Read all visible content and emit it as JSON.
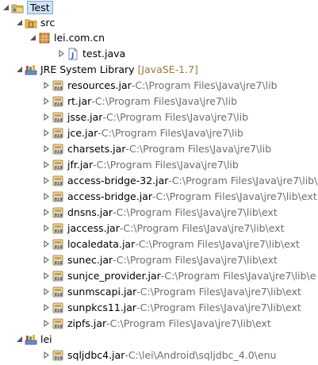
{
  "project": {
    "name": "Test"
  },
  "src": {
    "label": "src"
  },
  "package": {
    "label": "lei.com.cn"
  },
  "file": {
    "label": "test.java"
  },
  "jre": {
    "label": "JRE System Library",
    "version": "[JavaSE-1.7]"
  },
  "jars": [
    {
      "name": "resources.jar",
      "path": "C:\\Program Files\\Java\\jre7\\lib"
    },
    {
      "name": "rt.jar",
      "path": "C:\\Program Files\\Java\\jre7\\lib"
    },
    {
      "name": "jsse.jar",
      "path": "C:\\Program Files\\Java\\jre7\\lib"
    },
    {
      "name": "jce.jar",
      "path": "C:\\Program Files\\Java\\jre7\\lib"
    },
    {
      "name": "charsets.jar",
      "path": "C:\\Program Files\\Java\\jre7\\lib"
    },
    {
      "name": "jfr.jar",
      "path": "C:\\Program Files\\Java\\jre7\\lib"
    },
    {
      "name": "access-bridge-32.jar",
      "path": "C:\\Program Files\\Java\\jre7\\lib\\"
    },
    {
      "name": "access-bridge.jar",
      "path": "C:\\Program Files\\Java\\jre7\\lib\\ext"
    },
    {
      "name": "dnsns.jar",
      "path": "C:\\Program Files\\Java\\jre7\\lib\\ext"
    },
    {
      "name": "jaccess.jar",
      "path": "C:\\Program Files\\Java\\jre7\\lib\\ext"
    },
    {
      "name": "localedata.jar",
      "path": "C:\\Program Files\\Java\\jre7\\lib\\ext"
    },
    {
      "name": "sunec.jar",
      "path": "C:\\Program Files\\Java\\jre7\\lib\\ext"
    },
    {
      "name": "sunjce_provider.jar",
      "path": "C:\\Program Files\\Java\\jre7\\lib\\e"
    },
    {
      "name": "sunmscapi.jar",
      "path": "C:\\Program Files\\Java\\jre7\\lib\\ext"
    },
    {
      "name": "sunpkcs11.jar",
      "path": "C:\\Program Files\\Java\\jre7\\lib\\ext"
    },
    {
      "name": "zipfs.jar",
      "path": "C:\\Program Files\\Java\\jre7\\lib\\ext"
    }
  ],
  "lib": {
    "label": "lei"
  },
  "libjar": {
    "name": "sqljdbc4.jar",
    "path": "C:\\lei\\Android\\sqljdbc_4.0\\enu"
  },
  "separator": " - ",
  "colors": {
    "selection_bg": "#cfe3f7",
    "selection_border": "#7da2ce",
    "decoration": "#6e6e6e",
    "version": "#9a7b3c"
  }
}
